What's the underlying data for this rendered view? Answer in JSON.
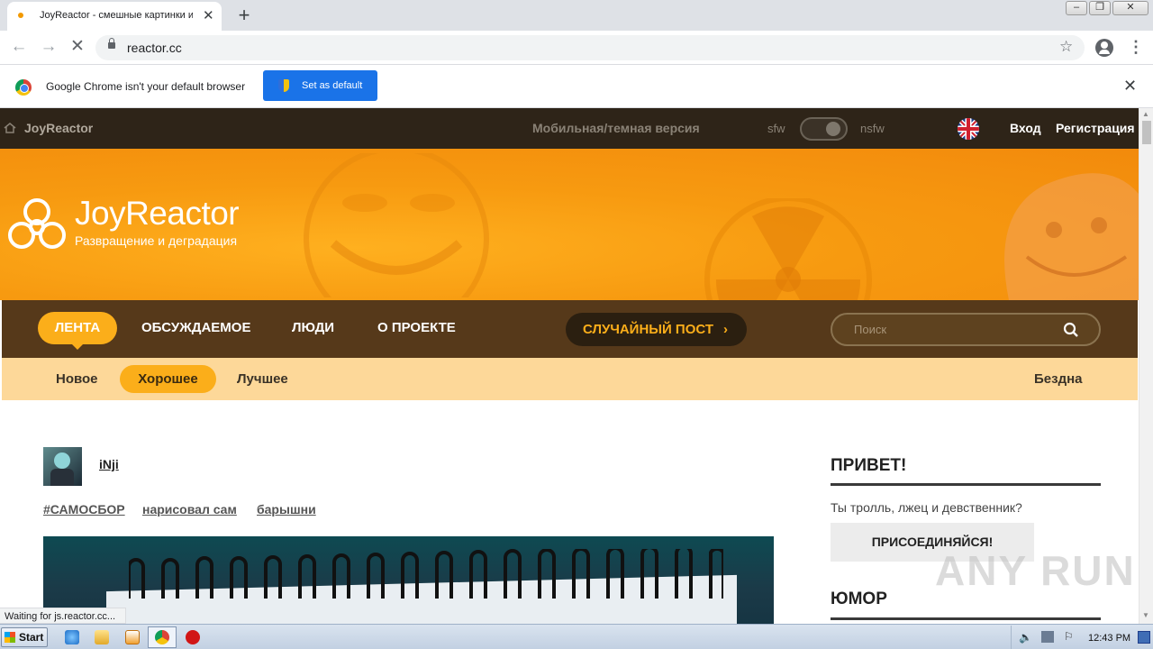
{
  "browser": {
    "tab_title": "JoyReactor - смешные картинки и",
    "url": "reactor.cc",
    "infobar_text": "Google Chrome isn't your default browser",
    "set_default_label": "Set as default",
    "status_text": "Waiting for js.reactor.cc..."
  },
  "site": {
    "topbar": {
      "brand": "JoyReactor",
      "mobile_link": "Мобильная/темная версия",
      "sfw": "sfw",
      "nsfw": "nsfw",
      "login": "Вход",
      "register": "Регистрация"
    },
    "banner": {
      "logo_text": "JoyReactor",
      "slogan": "Разврaщение и деградация"
    },
    "nav": {
      "items": [
        "ЛЕНТА",
        "ОБСУЖДАЕМОЕ",
        "ЛЮДИ",
        "О ПРОЕКТЕ"
      ],
      "random_post": "СЛУЧАЙНЫЙ ПОСТ",
      "search_placeholder": "Поиск"
    },
    "subnav": {
      "items": [
        "Новое",
        "Хорошее",
        "Лучшее"
      ],
      "abyss": "Бездна"
    },
    "post": {
      "author": "iNji",
      "tags": [
        "#САМОСБОР",
        "нарисовал сам",
        "барышни"
      ]
    },
    "sidebar": {
      "greeting_title": "ПРИВЕТ!",
      "greeting_text": "Ты тролль, лжец и девственник?",
      "join_button": "ПРИСОЕДИНЯЙСЯ!",
      "humor_title": "ЮМОР"
    },
    "watermark": "ANY RUN"
  },
  "taskbar": {
    "start_label": "Start",
    "clock": "12:43 PM"
  },
  "colors": {
    "accent_orange": "#fbae1a",
    "nav_brown": "#56391a",
    "topbar_dark": "#2e2418",
    "subnav_cream": "#fdd899",
    "chrome_blue": "#1a73e8"
  }
}
